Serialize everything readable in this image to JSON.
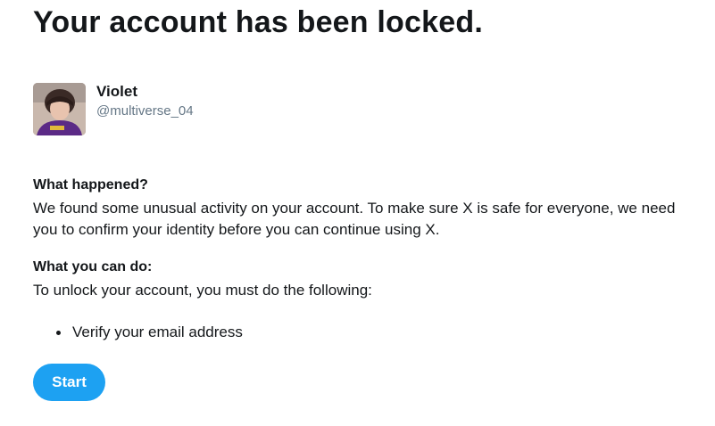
{
  "title": "Your account has been locked.",
  "user": {
    "name": "Violet",
    "handle": "@multiverse_04",
    "avatar": "profile-photo"
  },
  "what_happened": {
    "heading": "What happened?",
    "body": "We found some unusual activity on your account. To make sure X is safe for everyone, we need you to confirm your identity before you can continue using X."
  },
  "what_you_can_do": {
    "heading": "What you can do:",
    "body": "To unlock your account, you must do the following:",
    "steps": [
      "Verify your email address"
    ]
  },
  "start_button": {
    "label": "Start",
    "color": "#1da1f2"
  }
}
